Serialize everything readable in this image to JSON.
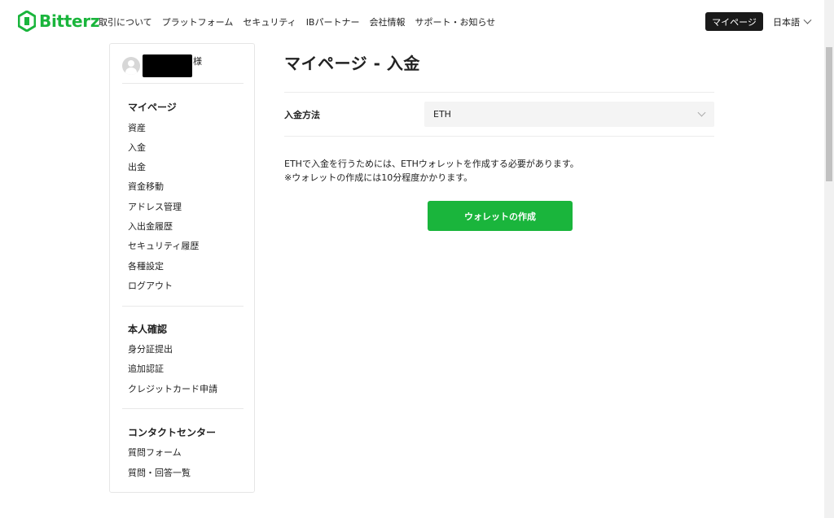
{
  "header": {
    "brand": "Bitterz",
    "nav": [
      "取引について",
      "プラットフォーム",
      "セキュリティ",
      "IBパートナー",
      "会社情報",
      "サポート・お知らせ"
    ],
    "mypage_button": "マイページ",
    "language": "日本語"
  },
  "sidebar": {
    "user_suffix": "様",
    "sections": [
      {
        "title": "マイページ",
        "items": [
          "資産",
          "入金",
          "出金",
          "資金移動",
          "アドレス管理",
          "入出金履歴",
          "セキュリティ履歴",
          "各種設定",
          "ログアウト"
        ]
      },
      {
        "title": "本人確認",
        "items": [
          "身分証提出",
          "追加認証",
          "クレジットカード申請"
        ]
      },
      {
        "title": "コンタクトセンター",
        "items": [
          "質問フォーム",
          "質問・回答一覧"
        ]
      }
    ]
  },
  "main": {
    "title": "マイページ - 入金",
    "method_label": "入金方法",
    "method_value": "ETH",
    "message_line1": "ETHで入金を行うためには、ETHウォレットを作成する必要があります。",
    "message_line2": "※ウォレットの作成には10分程度かかります。",
    "create_button": "ウォレットの作成"
  },
  "colors": {
    "brand_green": "#1ab53c",
    "dark_button": "#1a1a1a"
  }
}
